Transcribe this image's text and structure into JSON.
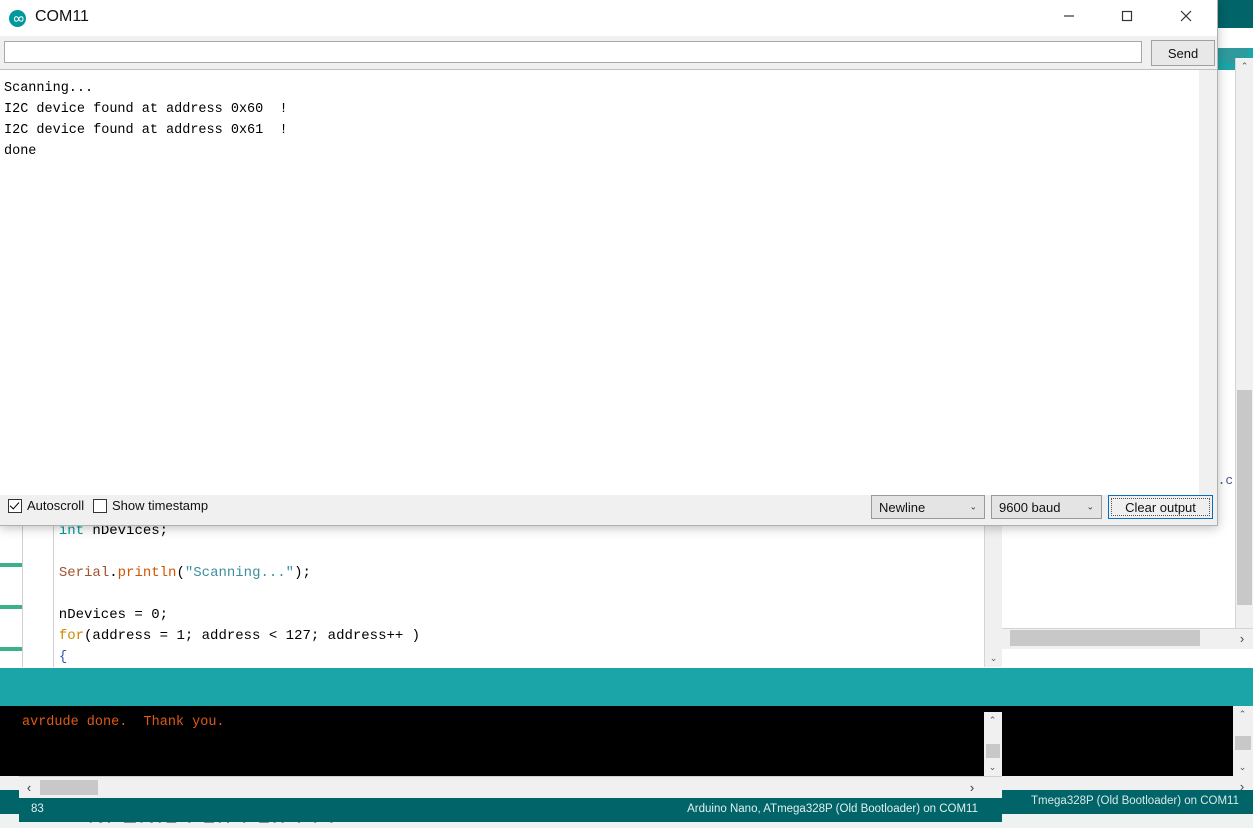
{
  "background_ide": {
    "editor_visible_text": ".cl",
    "status_right": "Tmega328P (Old Bootloader) on COM11",
    "taskbar_text": "NI ENIL I LII I LII I I I",
    "scroll_right_arrow": "›",
    "scroll_up_arrow": "⌃",
    "scroll_down_arrow": "⌄"
  },
  "serial_monitor": {
    "title": "COM11",
    "logo_icon": "arduino-infinity-icon",
    "window_controls": {
      "minimize": "—",
      "maximize": "□",
      "close": "✕"
    },
    "send_input": {
      "value": "",
      "placeholder": ""
    },
    "send_button_label": "Send",
    "output_lines": [
      "Scanning...",
      "I2C device found at address 0x60  !",
      "I2C device found at address 0x61  !",
      "done"
    ],
    "autoscroll": {
      "label": "Autoscroll",
      "checked": true
    },
    "show_timestamp": {
      "label": "Show timestamp",
      "checked": false
    },
    "line_ending_select": {
      "value": "Newline",
      "chevron": "⌄"
    },
    "baud_select": {
      "value": "9600 baud",
      "chevron": "⌄"
    },
    "clear_output_button": "Clear output"
  },
  "code_editor": {
    "lines": [
      {
        "tokens": [
          {
            "text": "  ",
            "cls": "k-op"
          },
          {
            "text": "int",
            "cls": "k-type"
          },
          {
            "text": " nDevices;",
            "cls": "k-op"
          }
        ]
      },
      {
        "tokens": [
          {
            "text": "",
            "cls": "k-op"
          }
        ]
      },
      {
        "tokens": [
          {
            "text": "  ",
            "cls": "k-op"
          },
          {
            "text": "Serial",
            "cls": "k-lib"
          },
          {
            "text": ".",
            "cls": "k-op"
          },
          {
            "text": "println",
            "cls": "k-fn"
          },
          {
            "text": "(",
            "cls": "k-op"
          },
          {
            "text": "\"Scanning...\"",
            "cls": "k-str"
          },
          {
            "text": ");",
            "cls": "k-op"
          }
        ]
      },
      {
        "tokens": [
          {
            "text": "",
            "cls": "k-op"
          }
        ]
      },
      {
        "tokens": [
          {
            "text": "  nDevices = 0;",
            "cls": "k-op"
          }
        ]
      },
      {
        "tokens": [
          {
            "text": "  ",
            "cls": "k-op"
          },
          {
            "text": "for",
            "cls": "k-kw"
          },
          {
            "text": "(address = 1; address < 127; address++ )",
            "cls": "k-op"
          }
        ]
      },
      {
        "tokens": [
          {
            "text": "  ",
            "cls": "k-op"
          },
          {
            "text": "{",
            "cls": "k-brace"
          }
        ]
      }
    ]
  },
  "console": {
    "text": "avrdude done.  Thank you.",
    "scroll_up": "⌃",
    "scroll_down": "⌄",
    "hscroll_left": "‹",
    "hscroll_right": "›"
  },
  "status_bar": {
    "line_number": "83",
    "board_info": "Arduino Nano, ATmega328P (Old Bootloader) on COM11"
  }
}
